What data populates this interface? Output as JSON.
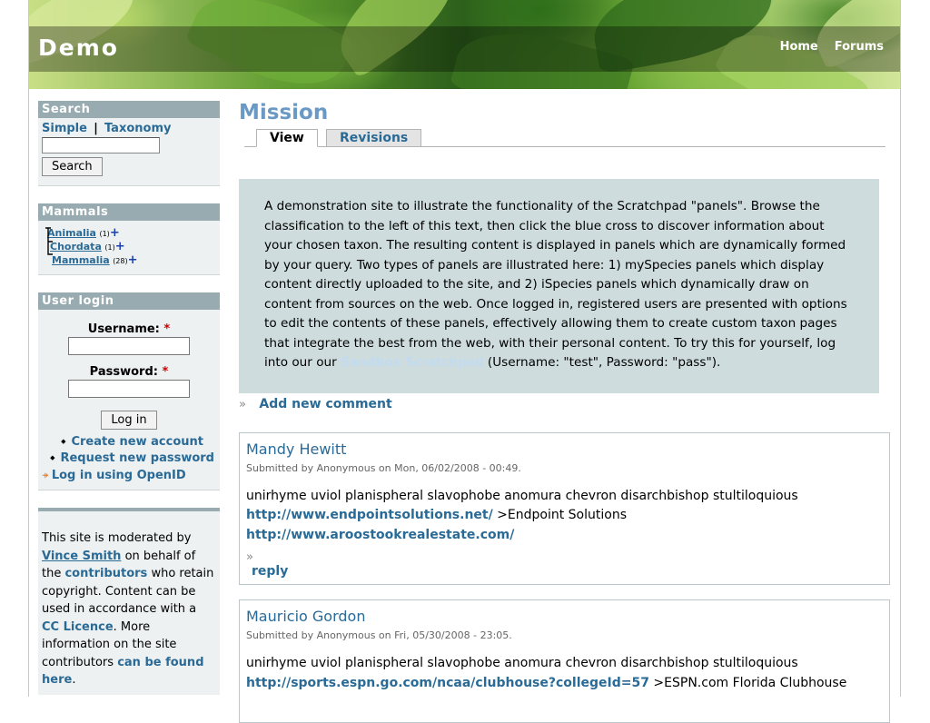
{
  "header": {
    "site_name": "Demo",
    "nav": [
      "Home",
      "Forums"
    ]
  },
  "search_block": {
    "title": "Search",
    "link_simple": "Simple",
    "separator": "|",
    "link_taxonomy": "Taxonomy",
    "button": "Search"
  },
  "mammals_block": {
    "title": "Mammals",
    "items": [
      {
        "label": "Animalia",
        "count": "(1)"
      },
      {
        "label": "Chordata",
        "count": "(1)"
      },
      {
        "label": "Mammalia",
        "count": "(28)"
      }
    ],
    "expand_glyph": "+"
  },
  "login_block": {
    "title": "User login",
    "username_label": "Username:",
    "password_label": "Password:",
    "required_mark": "*",
    "button": "Log in",
    "create_account": "Create new account",
    "request_password": "Request new password",
    "openid": "Log in using OpenID"
  },
  "about_block": {
    "t1": "This site is moderated by ",
    "l1": "Vince Smith",
    "t2": " on behalf of the ",
    "l2": "contributors",
    "t3": " who retain copyright. Content can be used in accordance with a ",
    "l3": "CC Licence",
    "t4": ". More information on the site contributors ",
    "l4": "can be found here",
    "t5": "."
  },
  "main": {
    "title": "Mission",
    "tabs": [
      "View",
      "Revisions"
    ],
    "mission_text": "A demonstration site to illustrate the functionality of the Scratchpad \"panels\". Browse the classification to the left of this text, then click the blue cross to discover information about your chosen taxon. The resulting content is displayed in panels which are dynamically formed by your query. Two types of panels are illustrated here: 1) mySpecies panels which display content directly uploaded to the site, and 2) iSpecies panels which dynamically draw on content from sources on the web. Once logged in, registered users are presented with options to edit the contents of these panels, effectively allowing them to create custom taxon pages that integrate the best from the web, with their personal content. To try this for yourself, log into our our ",
    "mission_link": "Sandbox Scratchpad",
    "mission_tail": " (Username: \"test\", Password: \"pass\").",
    "raquo": "»",
    "add_comment": "Add new comment"
  },
  "comments": [
    {
      "author": "Mandy Hewitt",
      "submitted": "Submitted by Anonymous on Mon, 06/02/2008 - 00:49.",
      "body": "unirhyme uviol planispheral slavophobe anomura chevron disarchbishop stultiloquious",
      "link1": "http://www.endpointsolutions.net/",
      "link1_text": " >Endpoint Solutions",
      "link2": "http://www.aroostookrealestate.com/",
      "raquo": "»",
      "reply": "reply"
    },
    {
      "author": "Mauricio Gordon",
      "submitted": "Submitted by Anonymous on Fri, 05/30/2008 - 23:05.",
      "body": "unirhyme uviol planispheral slavophobe anomura chevron disarchbishop stultiloquious",
      "link1": "http://sports.espn.go.com/ncaa/clubhouse?collegeId=57",
      "link1_text": " >ESPN.com Florida Clubhouse"
    }
  ]
}
